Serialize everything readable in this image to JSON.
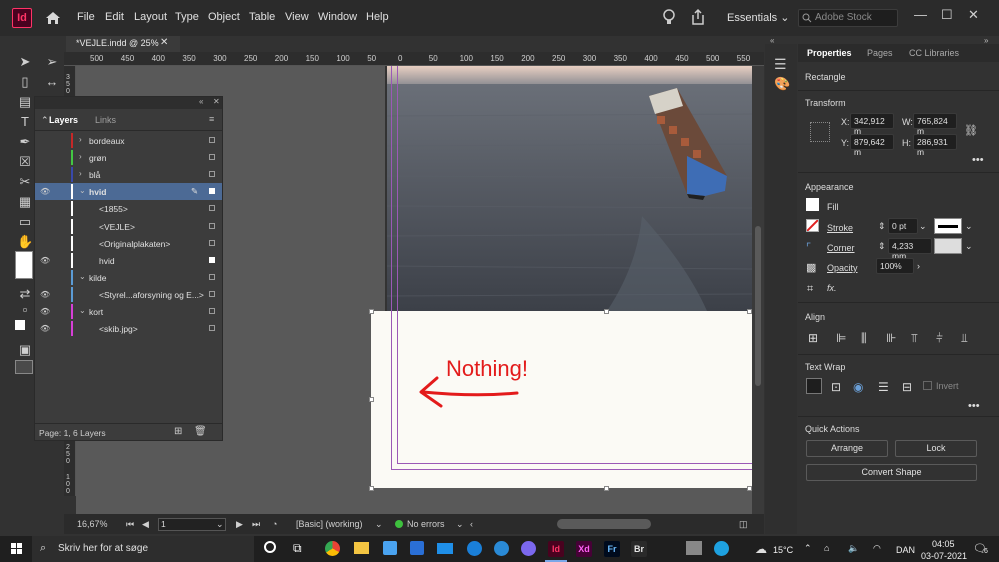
{
  "app": {
    "logo": "Id",
    "menu": [
      "File",
      "Edit",
      "Layout",
      "Type",
      "Object",
      "Table",
      "View",
      "Window",
      "Help"
    ],
    "workspace": "Essentials",
    "stock_placeholder": "Adobe Stock"
  },
  "document": {
    "tab_title": "*VEJLE.indd @ 25%",
    "ruler_ticks": [
      "500",
      "450",
      "400",
      "350",
      "300",
      "250",
      "200",
      "150",
      "100",
      "50",
      "0",
      "50",
      "100",
      "150",
      "200",
      "250",
      "300",
      "350",
      "400",
      "450",
      "500",
      "550"
    ],
    "annotation_text": "Nothing!"
  },
  "layers_panel": {
    "tabs": [
      "Layers",
      "Links"
    ],
    "rows": [
      {
        "name": "bordeaux",
        "indent": false,
        "chevron": "›",
        "eye": false,
        "color": "#c62828",
        "filled": false,
        "selected": false
      },
      {
        "name": "grøn",
        "indent": false,
        "chevron": "›",
        "eye": false,
        "color": "#43c743",
        "filled": false,
        "selected": false
      },
      {
        "name": "blå",
        "indent": false,
        "chevron": "›",
        "eye": false,
        "color": "#3949ab",
        "filled": false,
        "selected": false
      },
      {
        "name": "hvid",
        "indent": false,
        "chevron": "⌄",
        "eye": true,
        "color": "#ffffff",
        "filled": true,
        "selected": true
      },
      {
        "name": "<1855>",
        "indent": true,
        "chevron": "",
        "eye": false,
        "color": "#ffffff",
        "filled": false,
        "selected": false
      },
      {
        "name": "<VEJLE>",
        "indent": true,
        "chevron": "",
        "eye": false,
        "color": "#ffffff",
        "filled": false,
        "selected": false
      },
      {
        "name": "<Originalplakaten>",
        "indent": true,
        "chevron": "",
        "eye": false,
        "color": "#ffffff",
        "filled": false,
        "selected": false
      },
      {
        "name": "hvid",
        "indent": true,
        "chevron": "",
        "eye": true,
        "color": "#ffffff",
        "filled": true,
        "selected": false
      },
      {
        "name": "kilde",
        "indent": false,
        "chevron": "⌄",
        "eye": false,
        "color": "#5b9bd5",
        "filled": false,
        "selected": false
      },
      {
        "name": "<Styrel...aforsyning og E...>",
        "indent": true,
        "chevron": "",
        "eye": true,
        "color": "#5b9bd5",
        "filled": false,
        "selected": false
      },
      {
        "name": "kort",
        "indent": false,
        "chevron": "⌄",
        "eye": true,
        "color": "#d63fd6",
        "filled": false,
        "selected": false
      },
      {
        "name": "<skib.jpg>",
        "indent": true,
        "chevron": "",
        "eye": true,
        "color": "#d63fd6",
        "filled": false,
        "selected": false
      }
    ],
    "status": "Page: 1, 6 Layers"
  },
  "statusbar": {
    "zoom": "16,67%",
    "page": "1",
    "preflight_profile": "[Basic] (working)",
    "errors": "No errors"
  },
  "properties": {
    "tabs": [
      "Properties",
      "Pages",
      "CC Libraries"
    ],
    "object_type": "Rectangle",
    "transform_heading": "Transform",
    "x_label": "X:",
    "x": "342,912 m",
    "y_label": "Y:",
    "y": "879,642 m",
    "w_label": "W:",
    "w": "765,824 m",
    "h_label": "H:",
    "h": "286,931 m",
    "appearance_heading": "Appearance",
    "fill_label": "Fill",
    "stroke_label": "Stroke",
    "stroke_value": "0 pt",
    "corner_label": "Corner",
    "corner_value": "4,233 mm",
    "opacity_label": "Opacity",
    "opacity_value": "100%",
    "fx_label": "fx.",
    "align_heading": "Align",
    "textwrap_heading": "Text Wrap",
    "invert_label": "Invert",
    "quick_actions_heading": "Quick Actions",
    "arrange_label": "Arrange",
    "lock_label": "Lock",
    "convert_shape_label": "Convert Shape"
  },
  "taskbar": {
    "search_placeholder": "Skriv her for at søge",
    "weather": "15°C",
    "language": "DAN",
    "time": "04:05",
    "date": "03-07-2021",
    "notification_count": "6",
    "apps": [
      {
        "label": "Id",
        "color": "#ff3366",
        "bg": "#49021f"
      },
      {
        "label": "Xd",
        "color": "#ff61f6",
        "bg": "#470137"
      },
      {
        "label": "Fr",
        "color": "#6bbcff",
        "bg": "#000b1d"
      },
      {
        "label": "Br",
        "color": "#e6e6e6",
        "bg": "#2a2a2a"
      }
    ]
  }
}
